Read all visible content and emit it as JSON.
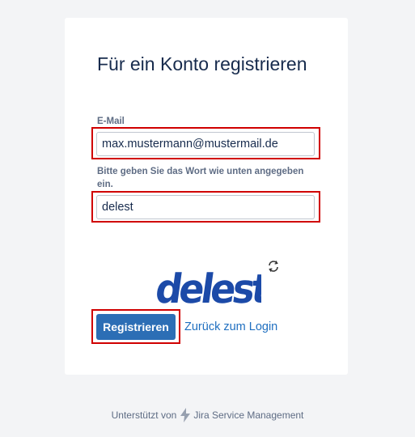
{
  "form": {
    "title": "Für ein Konto registrieren",
    "email_label": "E-Mail",
    "email_value": "max.mustermann@mustermail.de",
    "captcha_label": "Bitte geben Sie das Wort wie unten angegeben ein.",
    "captcha_value": "delest",
    "captcha_word": "delest",
    "submit_label": "Registrieren",
    "back_link": "Zurück zum Login"
  },
  "footer": {
    "prefix": "Unterstützt von",
    "product": "Jira Service Management"
  },
  "colors": {
    "primary": "#2c6eb5",
    "highlight": "#d00000",
    "captcha_text": "#1c4aa8"
  },
  "icons": [
    "refresh-icon",
    "lightning-bolt-icon"
  ]
}
